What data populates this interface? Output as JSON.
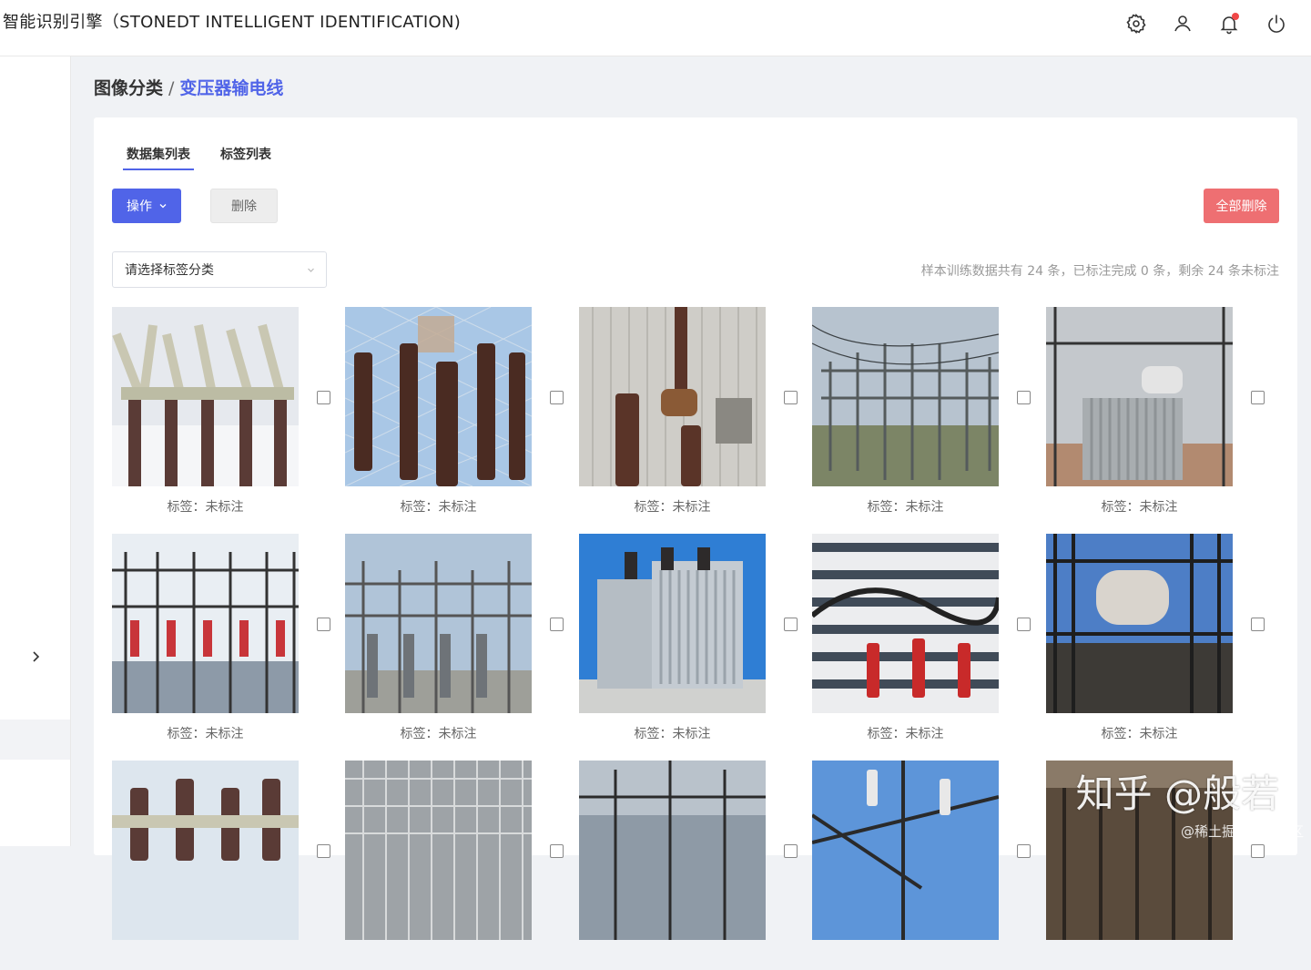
{
  "header": {
    "title": "智能识别引擎（STONEDT INTELLIGENT IDENTIFICATION)",
    "icons": [
      "gear-icon",
      "user-icon",
      "bell-icon",
      "power-icon"
    ]
  },
  "breadcrumb": {
    "root": "图像分类",
    "separator": "/",
    "current": "变压器输电线"
  },
  "tabs": [
    {
      "label": "数据集列表",
      "active": true
    },
    {
      "label": "标签列表",
      "active": false
    }
  ],
  "toolbar": {
    "operate_label": "操作",
    "delete_label": "删除",
    "delete_all_label": "全部删除"
  },
  "filter": {
    "placeholder": "请选择标签分类"
  },
  "summary": "样本训练数据共有 24 条，已标注完成 0 条，剩余 24 条未标注",
  "items": [
    {
      "label": "标签：未标注"
    },
    {
      "label": "标签：未标注"
    },
    {
      "label": "标签：未标注"
    },
    {
      "label": "标签：未标注"
    },
    {
      "label": "标签：未标注"
    },
    {
      "label": "标签：未标注"
    },
    {
      "label": "标签：未标注"
    },
    {
      "label": "标签：未标注"
    },
    {
      "label": "标签：未标注"
    },
    {
      "label": "标签：未标注"
    },
    {
      "label": ""
    },
    {
      "label": ""
    },
    {
      "label": ""
    },
    {
      "label": ""
    },
    {
      "label": ""
    }
  ],
  "watermark": {
    "main": "知乎 @般若",
    "sub": "@稀土掘金技术社区"
  },
  "colors": {
    "accent": "#5064e8",
    "danger": "#ee6f72",
    "notification": "#f04848"
  }
}
